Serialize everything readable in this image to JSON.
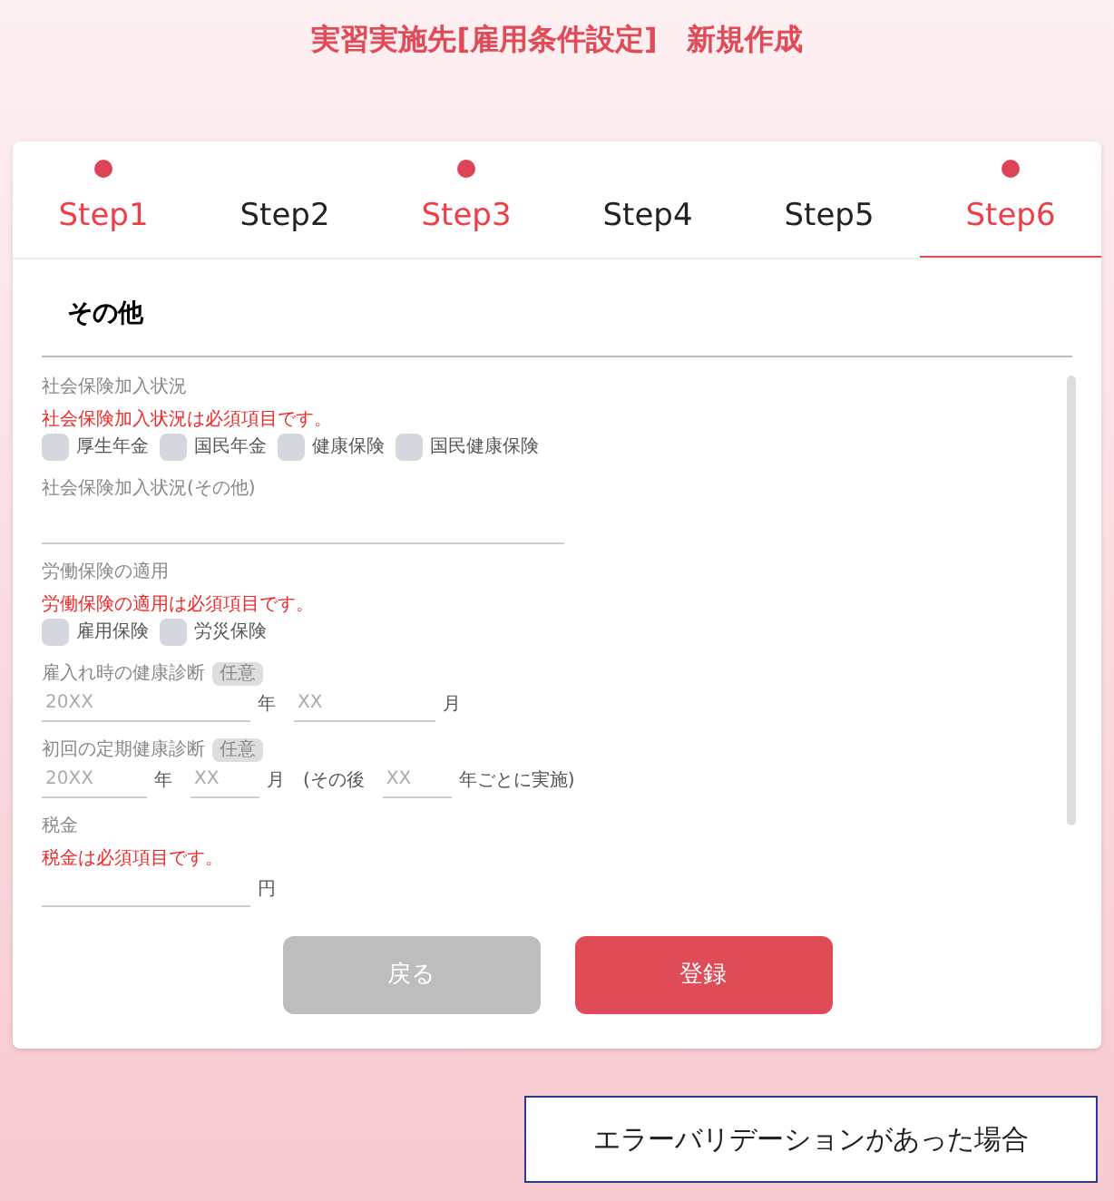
{
  "page_title": "実習実施先[雇用条件設定]　新規作成",
  "steps": [
    {
      "label": "Step1",
      "error": true,
      "selected": false
    },
    {
      "label": "Step2",
      "error": false,
      "selected": false
    },
    {
      "label": "Step3",
      "error": true,
      "selected": false
    },
    {
      "label": "Step4",
      "error": false,
      "selected": false
    },
    {
      "label": "Step5",
      "error": false,
      "selected": false
    },
    {
      "label": "Step6",
      "error": true,
      "selected": true
    }
  ],
  "section_title": "その他",
  "fields": [
    {
      "kind": "checkboxes",
      "label": "社会保険加入状況",
      "error": "社会保険加入状況は必須項目です。",
      "options": [
        {
          "label": "厚生年金",
          "checked": false
        },
        {
          "label": "国民年金",
          "checked": false
        },
        {
          "label": "健康保険",
          "checked": false
        },
        {
          "label": "国民健康保険",
          "checked": false
        }
      ]
    },
    {
      "kind": "text",
      "label": "社会保険加入状況(その他)"
    },
    {
      "kind": "checkboxes",
      "label": "労働保険の適用",
      "error": "労働保険の適用は必須項目です。",
      "options": [
        {
          "label": "雇用保険",
          "checked": false
        },
        {
          "label": "労災保険",
          "checked": false
        }
      ]
    },
    {
      "kind": "date",
      "label": "雇入れ時の健康診断",
      "badge": "任意",
      "parts": [
        {
          "kind": "field",
          "placeholder": "20XX"
        },
        {
          "kind": "unit",
          "unit": "年"
        },
        {
          "kind": "field",
          "placeholder": "XX"
        },
        {
          "kind": "unit",
          "unit": "月"
        }
      ]
    },
    {
      "kind": "interval",
      "label": "初回の定期健康診断",
      "badge": "任意",
      "parts": [
        {
          "kind": "field",
          "placeholder": "20XX"
        },
        {
          "kind": "unit",
          "unit": "年"
        },
        {
          "kind": "field",
          "placeholder": "XX"
        },
        {
          "kind": "unit",
          "unit": "月"
        },
        {
          "kind": "unit",
          "unit": "(その後"
        },
        {
          "kind": "field",
          "placeholder": "XX"
        },
        {
          "kind": "unit",
          "unit": "年ごとに実施)"
        }
      ]
    },
    {
      "kind": "amount",
      "label": "税金",
      "error": "税金は必須項目です。",
      "parts": [
        {
          "kind": "field"
        },
        {
          "kind": "unit",
          "unit": "円"
        }
      ]
    }
  ],
  "buttons": [
    {
      "label": "戻る",
      "kind": "back"
    },
    {
      "label": "登録",
      "kind": "submit"
    }
  ],
  "note": "エラーバリデーションがあった場合"
}
